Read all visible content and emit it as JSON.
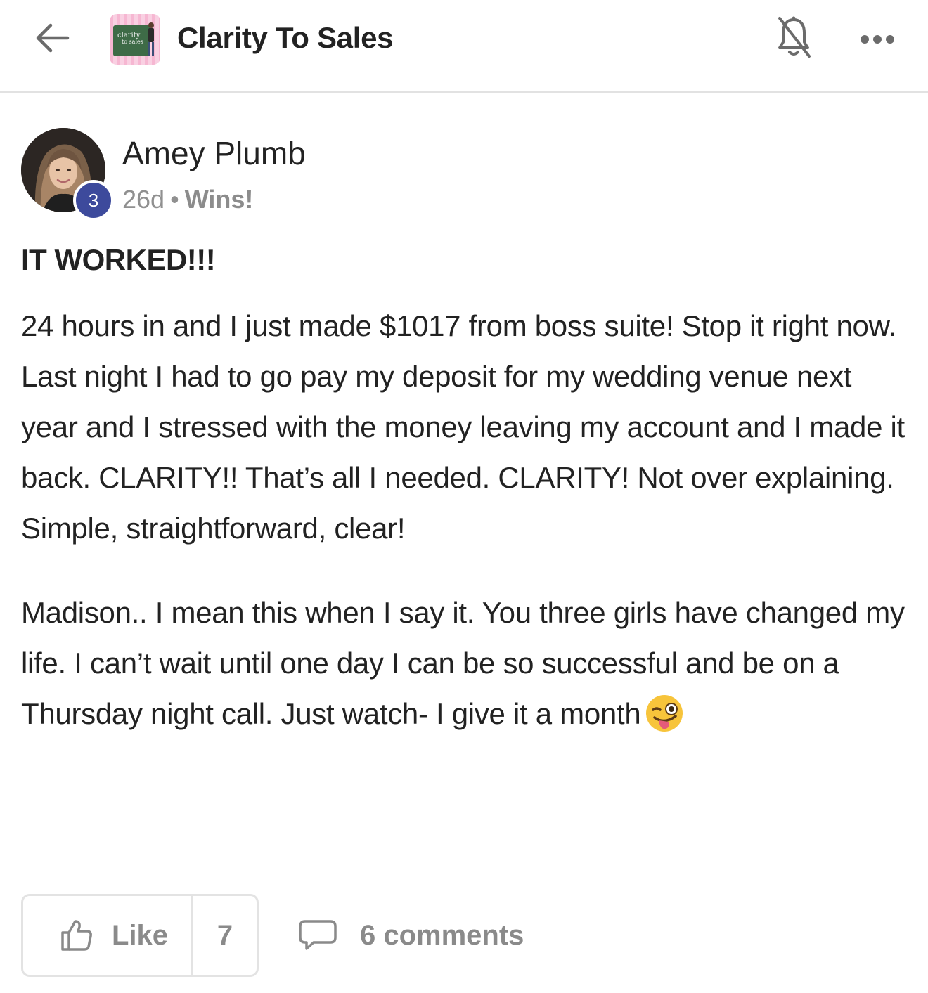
{
  "header": {
    "group_name": "Clarity To Sales",
    "logo_text_line1": "clarity",
    "logo_text_line2": "to sales",
    "icons": {
      "back": "arrow-left-icon",
      "notifications": "bell-off-icon",
      "more": "more-horizontal-icon"
    }
  },
  "post": {
    "author": "Amey Plumb",
    "level": "3",
    "age": "26d",
    "separator": "•",
    "category": "Wins!",
    "title": "IT WORKED!!!",
    "paragraph1": "24 hours in and I just made $1017 from boss suite! Stop it right now. Last night I had to go pay my deposit for my wedding venue next year and I stressed with the money leaving my account and I made it back. CLARITY!! That’s all I needed. CLARITY! Not over explaining. Simple, straightforward, clear!",
    "paragraph2": "Madison.. I mean this when I say it. You three girls have changed my life. I can’t wait until one day I can be so successful and be on a Thursday night call. Just watch- I give it a month",
    "emoji": "winking-face-with-tongue"
  },
  "actions": {
    "like_label": "Like",
    "like_count": "7",
    "comments_label": "6 comments",
    "icons": {
      "like": "thumbs-up-icon",
      "comments": "comment-bubble-icon"
    }
  },
  "colors": {
    "text": "#222222",
    "muted": "#909090",
    "badge": "#3d4a9c",
    "divider": "#e2e2e2"
  }
}
